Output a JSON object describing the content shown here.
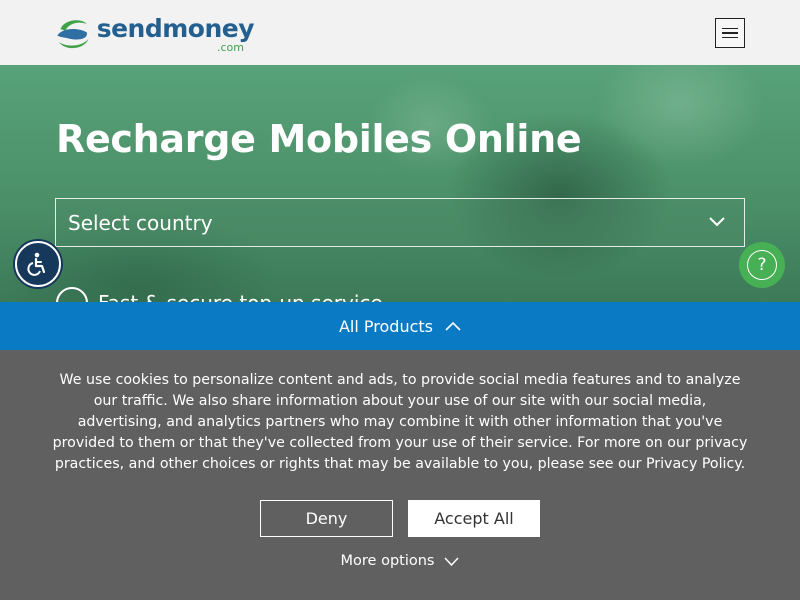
{
  "header": {
    "logo_name": "sendmoney",
    "logo_suffix": ".com",
    "menu_icon": "hamburger-icon"
  },
  "hero": {
    "title": "Recharge Mobiles Online",
    "country_select": {
      "value": "Select country",
      "icon": "chevron-down-icon"
    },
    "feature_text": "Fast & secure top-up service"
  },
  "floating": {
    "accessibility_icon": "wheelchair-icon",
    "help_label": "?"
  },
  "products_bar": {
    "label": "All Products",
    "icon": "chevron-up-icon"
  },
  "cookie_banner": {
    "text": "We use cookies to personalize content and ads, to provide social media features and to analyze our traffic. We also share information about your use of our site with our social media, advertising, and analytics partners who may combine it with other information that you've provided to them or that they've collected from your use of their service. For more on our privacy practices, and other choices or rights that may be available to you, please see our Privacy Policy.",
    "deny_label": "Deny",
    "accept_label": "Accept All",
    "more_options_label": "More options"
  },
  "colors": {
    "header_bg": "#f2f2f2",
    "brand_blue": "#24608f",
    "brand_green": "#3fa24a",
    "products_bar": "#0b7ac4",
    "cookie_bg": "#606060",
    "help_green": "#47b055",
    "access_navy": "#16385a"
  }
}
